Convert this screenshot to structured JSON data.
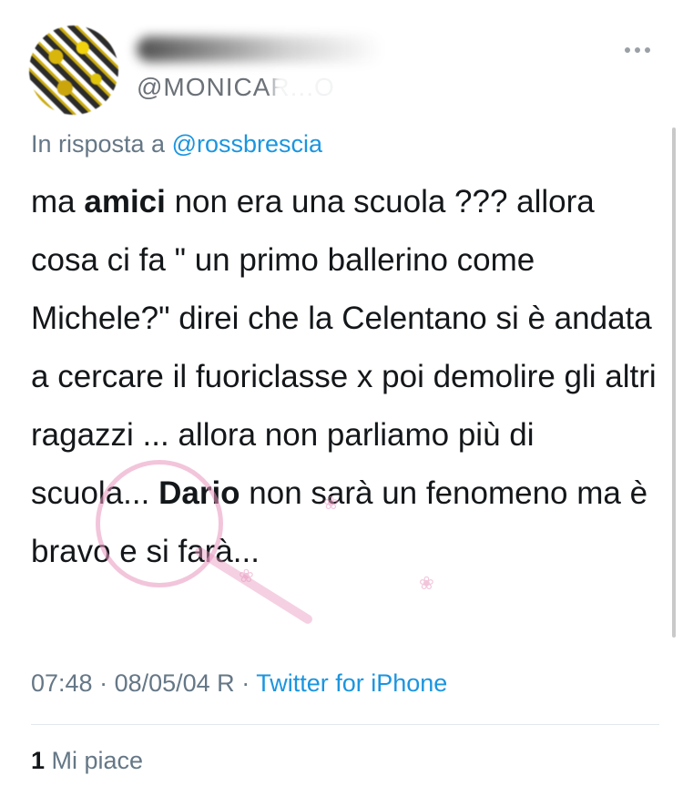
{
  "user": {
    "handle": "@MONICAR...O"
  },
  "reply": {
    "prefix": "In risposta a ",
    "mention": "@rossbrescia"
  },
  "tweet": {
    "segments": [
      {
        "text": "ma ",
        "bold": false
      },
      {
        "text": "amici",
        "bold": true
      },
      {
        "text": " non era una scuola ??? allora cosa ci fa \" un primo ballerino come Michele?\" direi che la Celentano si è andata a cercare il fuoriclasse x poi demolire gli altri ragazzi ... allora non parliamo più di scuola... ",
        "bold": false
      },
      {
        "text": "Dario",
        "bold": true
      },
      {
        "text": " non sarà un fenomeno ma è bravo e si farà...",
        "bold": false
      }
    ]
  },
  "meta": {
    "time": "07:48",
    "date": "08/05/04 R",
    "separator": " · ",
    "source": "Twitter for iPhone"
  },
  "likes": {
    "count": "1",
    "label": " Mi piace"
  },
  "icons": {
    "more": "more-dots-icon",
    "watermark": "magnifier-watermark-icon",
    "paw": "paw-icon"
  },
  "colors": {
    "link": "#1b95e0",
    "secondary": "#657786",
    "text": "#14171a"
  }
}
